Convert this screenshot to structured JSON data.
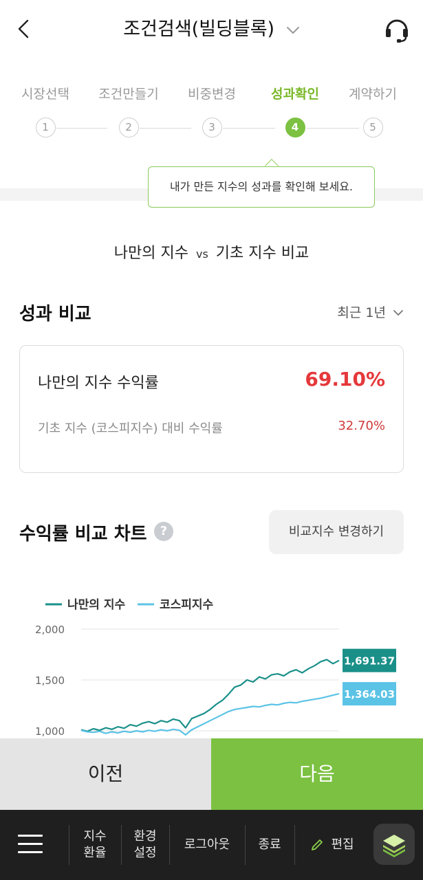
{
  "header": {
    "title": "조건검색(빌딩블록)"
  },
  "steps": [
    {
      "label": "시장선택",
      "num": "1"
    },
    {
      "label": "조건만들기",
      "num": "2"
    },
    {
      "label": "비중변경",
      "num": "3"
    },
    {
      "label": "성과확인",
      "num": "4"
    },
    {
      "label": "계약하기",
      "num": "5"
    }
  ],
  "tooltip": "내가 만든 지수의 성과를 확인해 보세요.",
  "compare": {
    "left": "나만의 지수",
    "vs": "vs",
    "right": "기초 지수 비교"
  },
  "performance": {
    "title": "성과 비교",
    "period": "최근 1년",
    "my_label": "나만의 지수 수익률",
    "my_value": "69.10%",
    "base_label": "기초 지수 (코스피지수) 대비 수익률",
    "base_value": "32.70%"
  },
  "chart_section": {
    "title": "수익률 비교 차트",
    "help": "?",
    "change_button": "비교지수 변경하기"
  },
  "chart_data": {
    "type": "line",
    "y_ticks": [
      "2,000",
      "1,500",
      "1,000"
    ],
    "ylim": [
      1000,
      2000
    ],
    "series": [
      {
        "name": "나만의 지수",
        "color": "#1a9089",
        "end_label": "1,691.37",
        "values": [
          1010,
          995,
          1020,
          1005,
          1030,
          1015,
          1040,
          1025,
          1060,
          1045,
          1075,
          1090,
          1070,
          1100,
          1085,
          1115,
          1100,
          1030,
          1120,
          1145,
          1170,
          1210,
          1260,
          1300,
          1360,
          1430,
          1450,
          1500,
          1480,
          1530,
          1510,
          1550,
          1560,
          1540,
          1580,
          1600,
          1570,
          1610,
          1640,
          1680,
          1700,
          1660,
          1691.37
        ]
      },
      {
        "name": "코스피지수",
        "color": "#5bc3e6",
        "end_label": "1,364.03",
        "values": [
          1005,
          990,
          985,
          995,
          975,
          990,
          980,
          995,
          985,
          1000,
          990,
          1005,
          995,
          1010,
          1000,
          1015,
          1005,
          960,
          1010,
          1040,
          1070,
          1100,
          1130,
          1160,
          1190,
          1210,
          1220,
          1230,
          1240,
          1235,
          1250,
          1260,
          1255,
          1270,
          1280,
          1275,
          1290,
          1300,
          1310,
          1320,
          1335,
          1350,
          1364.03
        ]
      }
    ]
  },
  "footer": {
    "prev": "이전",
    "next": "다음"
  },
  "bottom_nav": {
    "index_fx_1": "지수",
    "index_fx_2": "환율",
    "env_1": "환경",
    "env_2": "설정",
    "logout": "로그아웃",
    "exit": "종료",
    "edit": "편집"
  }
}
